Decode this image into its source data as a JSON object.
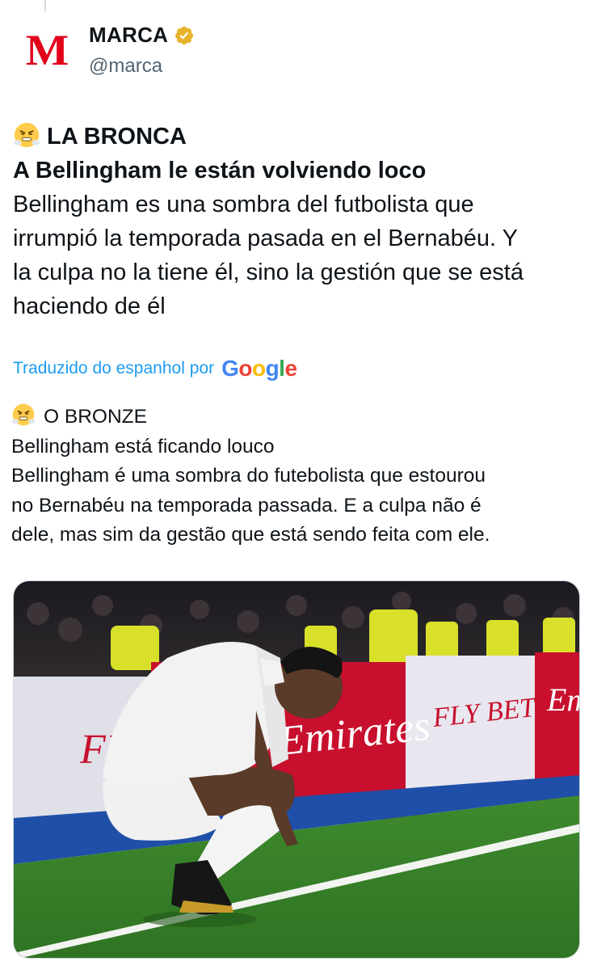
{
  "tweet": {
    "author": {
      "name": "MARCA",
      "handle": "@marca",
      "avatar_letter": "M",
      "verified": true,
      "verified_color": "#e8b32c"
    },
    "original": {
      "emoji": "face-with-steam-from-nose",
      "kicker": "LA BRONCA",
      "headline": "A Bellingham le están volviendo loco",
      "body_lines": [
        "Bellingham es una sombra del futbolista que",
        "irrumpió la temporada pasada en el Bernabéu. Y",
        "la culpa no la tiene él, sino la gestión que se está",
        "haciendo de él"
      ]
    },
    "translation": {
      "label": "Traduzido do espanhol por",
      "provider": "Google",
      "emoji": "face-with-steam-from-nose",
      "kicker": "O BRONZE",
      "headline": "Bellingham está ficando louco",
      "body_lines": [
        "Bellingham é uma sombra do futebolista que estourou",
        "no Bernabéu na temporada passada. E a culpa não é",
        "dele, mas sim da gestão que está sendo feita com ele."
      ]
    },
    "media": {
      "billboard_texts": [
        "FLY",
        "Emirates",
        "FLY BETTER",
        "Em"
      ]
    }
  },
  "colors": {
    "link": "#1d9bf0",
    "brand_red": "#e2001a",
    "secondary_text": "#536471"
  }
}
